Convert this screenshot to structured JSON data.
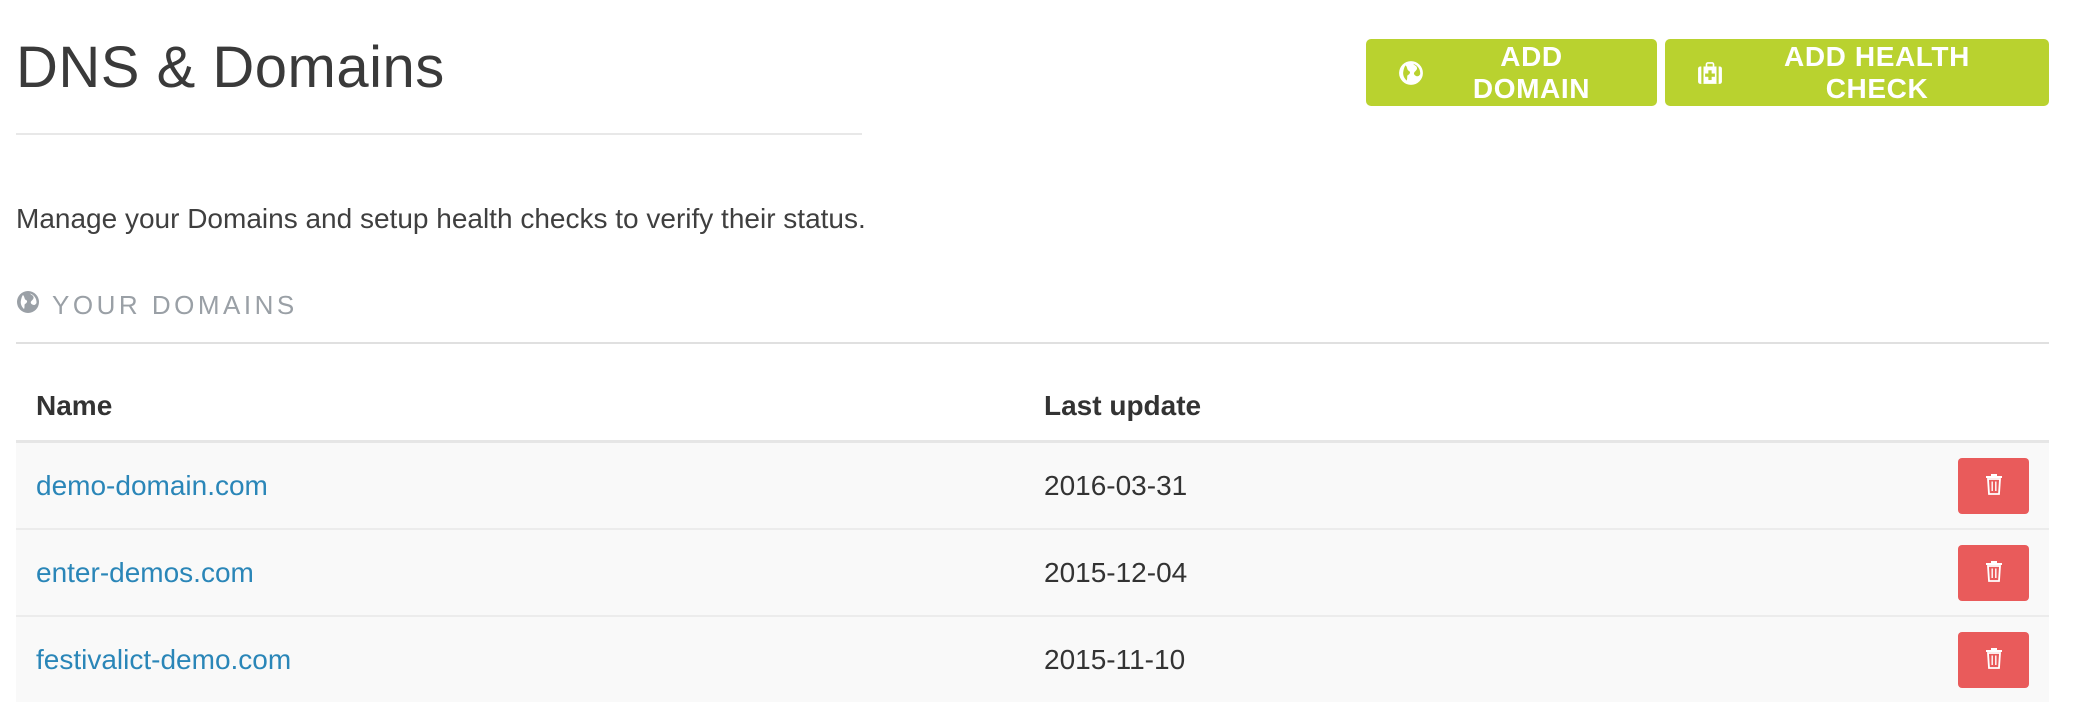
{
  "header": {
    "title": "DNS & Domains",
    "add_domain_label": "ADD DOMAIN",
    "add_health_check_label": "ADD HEALTH CHECK"
  },
  "intro": "Manage your Domains and setup health checks to verify their status.",
  "section": {
    "heading": "YOUR DOMAINS",
    "icon": "globe-icon"
  },
  "table": {
    "columns": [
      "Name",
      "Last update",
      ""
    ],
    "rows": [
      {
        "name": "demo-domain.com",
        "last_update": "2016-03-31"
      },
      {
        "name": "enter-demos.com",
        "last_update": "2015-12-04"
      },
      {
        "name": "festivalict-demo.com",
        "last_update": "2015-11-10"
      }
    ]
  },
  "icons": {
    "add_domain": "globe-icon",
    "add_health_check": "medkit-icon",
    "delete": "trash-icon"
  },
  "colors": {
    "accent": "#b9d22f",
    "danger": "#e95b5b",
    "link": "#2a86b8",
    "muted": "#9aa0a6"
  }
}
